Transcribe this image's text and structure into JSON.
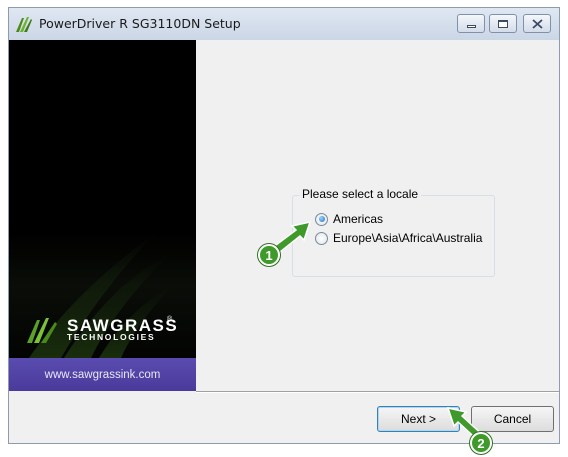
{
  "window": {
    "title": "PowerDriver R SG3110DN Setup",
    "controls": [
      "minimize-icon",
      "maximize-icon",
      "close-icon"
    ]
  },
  "banner": {
    "logo_main": "SAWGRASS",
    "logo_tm": "®",
    "logo_sub": "TECHNOLOGIES",
    "url": "www.sawgrassink.com",
    "accent_color": "#4a3a9a",
    "brand_green": "#4a8a1c"
  },
  "locale_group": {
    "legend": "Please select a locale",
    "options": [
      {
        "label": "Americas",
        "selected": true
      },
      {
        "label": "Europe\\Asia\\Africa\\Australia",
        "selected": false
      }
    ]
  },
  "buttons": {
    "next": "Next >",
    "cancel": "Cancel"
  },
  "annotations": {
    "step1": "1",
    "step2": "2",
    "color": "#3f9a2b"
  }
}
